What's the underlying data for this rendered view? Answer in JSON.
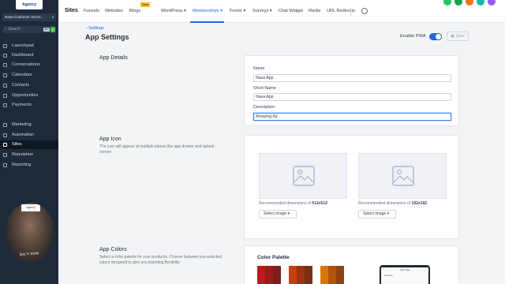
{
  "sidebar": {
    "logo_text": "Agency",
    "account_name": "Nasa Customer Servic...",
    "search_placeholder": "Search",
    "search_shortcut": "⌘K",
    "items": [
      {
        "label": "Launchpad"
      },
      {
        "label": "Dashboard"
      },
      {
        "label": "Conversations"
      },
      {
        "label": "Calendars"
      },
      {
        "label": "Contacts"
      },
      {
        "label": "Opportunities"
      },
      {
        "label": "Payments"
      },
      {
        "label": "Marketing"
      },
      {
        "label": "Automation"
      },
      {
        "label": "Sites",
        "active": true
      },
      {
        "label": "Reputation"
      },
      {
        "label": "Reporting"
      }
    ]
  },
  "webcam": {
    "frame_text": "Agency",
    "caption": "tips 'n' tricks"
  },
  "topbar": {
    "title": "Sites",
    "links": [
      "Funnels",
      "Websites",
      "Blogs",
      "WordPress",
      "Memberships",
      "Forms",
      "Surveys",
      "Chat Widget",
      "Media",
      "URL Redirects"
    ],
    "new_badge": "New",
    "active_link": "Memberships"
  },
  "page": {
    "back_label": "Settings",
    "title": "App Settings",
    "pwa_label": "Enable PWA",
    "pwa_enabled": true,
    "save_label": "Save"
  },
  "app_details": {
    "section_title": "App Details",
    "name_label": "Name",
    "name_value": "Nasa App",
    "short_name_label": "Short Name",
    "short_name_value": "Nasa App",
    "description_label": "Description",
    "description_value": "Amazing Ap"
  },
  "app_icon": {
    "section_title": "App Icon",
    "section_desc": "The icon will appear at multiple places like app drawer and splash screen",
    "rec_prefix": "Recommended dimensions of",
    "large_size": "512x512",
    "small_size": "192x192",
    "select_label": "Select Image"
  },
  "app_colors": {
    "section_title": "App Colors",
    "section_desc": "Select a color palette for your products. Choose between pre-selected colors designed to give you branding flexibility",
    "palette_title": "Color Palette",
    "preview_title": "Your Logo",
    "preview_item": "Content",
    "swatches": [
      [
        "#b91c1c",
        "#991b1b",
        "#7f1d1d"
      ],
      [
        "#c2410c",
        "#9a3412",
        "#7c2d12"
      ],
      [
        "#d97706",
        "#b45309",
        "#92400e"
      ]
    ]
  },
  "colors": {
    "accent": "#2563eb",
    "sidebar_bg": "#1e2a3a"
  }
}
